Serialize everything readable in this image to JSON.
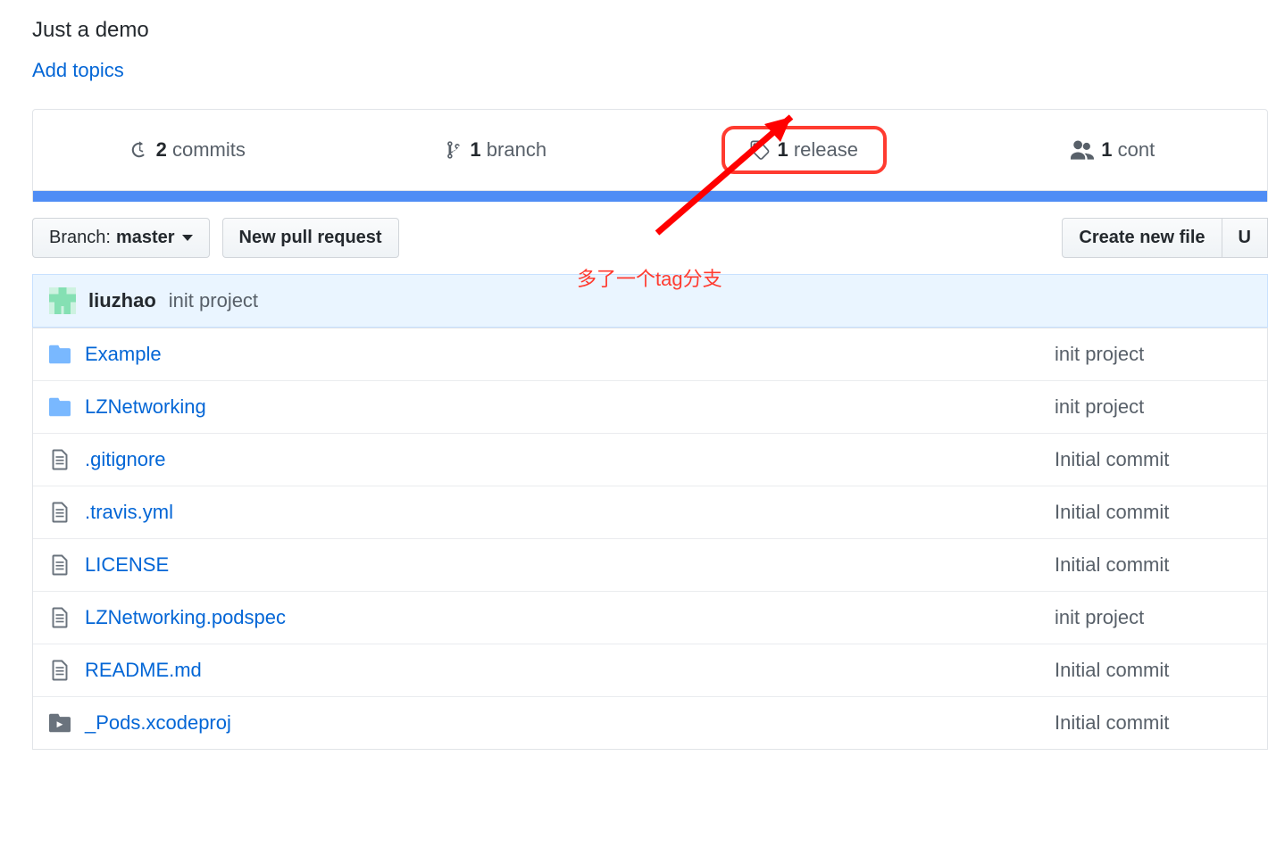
{
  "description": "Just a demo",
  "add_topics_label": "Add topics",
  "stats": {
    "commits": {
      "count": "2",
      "label": "commits"
    },
    "branches": {
      "count": "1",
      "label": "branch"
    },
    "releases": {
      "count": "1",
      "label": "release"
    },
    "contributors": {
      "count": "1",
      "label": "cont"
    }
  },
  "annotation": "多了一个tag分支",
  "toolbar": {
    "branch_prefix": "Branch:",
    "branch_name": "master",
    "new_pr": "New pull request",
    "create_file": "Create new file",
    "upload": "U"
  },
  "latest_commit": {
    "author": "liuzhao",
    "message": "init project"
  },
  "files": [
    {
      "type": "folder",
      "name": "Example",
      "message": "init project"
    },
    {
      "type": "folder",
      "name": "LZNetworking",
      "message": "init project"
    },
    {
      "type": "file",
      "name": ".gitignore",
      "message": "Initial commit"
    },
    {
      "type": "file",
      "name": ".travis.yml",
      "message": "Initial commit"
    },
    {
      "type": "file",
      "name": "LICENSE",
      "message": "Initial commit"
    },
    {
      "type": "file",
      "name": "LZNetworking.podspec",
      "message": "init project"
    },
    {
      "type": "file",
      "name": "README.md",
      "message": "Initial commit"
    },
    {
      "type": "submodule",
      "name": "_Pods.xcodeproj",
      "message": "Initial commit"
    }
  ]
}
